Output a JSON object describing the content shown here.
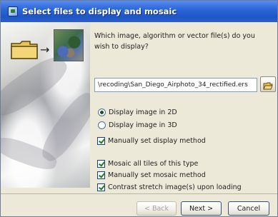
{
  "window": {
    "title": "Select files to display and mosaic",
    "colors": {
      "titlebar": "#2b67d8",
      "body": "#ece9d8"
    }
  },
  "banner": {
    "icons": [
      "folder-icon",
      "arrow-icon",
      "map-image-icon"
    ],
    "arrow": "→"
  },
  "question": "Which image, algorithm or vector file(s) do you wish to display?",
  "file_path": {
    "value": "\\recoding\\San_Diego_Airphoto_34_rectified.ers",
    "browse_icon": "open-folder-icon"
  },
  "display_options": [
    {
      "label": "Display image in 2D",
      "checked": true
    },
    {
      "label": "Display image in 3D",
      "checked": false
    }
  ],
  "options_a": [
    {
      "label": "Manually set display method",
      "checked": true
    }
  ],
  "options_b": [
    {
      "label": "Mosaic all tiles of this type",
      "checked": true
    },
    {
      "label": "Manually set mosaic method",
      "checked": true
    },
    {
      "label": "Contrast stretch image(s) upon loading",
      "checked": true
    }
  ],
  "footer": {
    "back": "< Back",
    "next": "Next >",
    "cancel": "Cancel"
  }
}
